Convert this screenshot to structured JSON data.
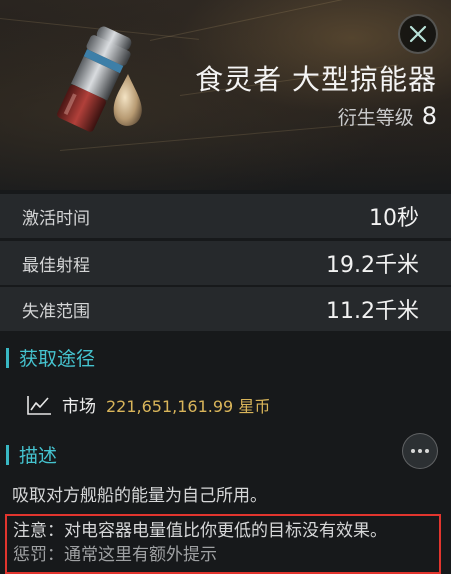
{
  "header": {
    "title": "食灵者 大型掠能器",
    "meta_label": "衍生等级",
    "meta_value": "8",
    "close_icon": "close-x-icon",
    "item_icon": "energy-canister-icon"
  },
  "attributes": [
    {
      "label": "激活时间",
      "value": "10秒"
    },
    {
      "label": "最佳射程",
      "value": "19.2千米"
    },
    {
      "label": "失准范围",
      "value": "11.2千米"
    }
  ],
  "acquisition": {
    "title": "获取途径",
    "market_icon": "market-chart-icon",
    "market_label": "市场",
    "market_price": "221,651,161.99 星币"
  },
  "description": {
    "title": "描述",
    "more_icon": "more-dots-icon",
    "text": "吸取对方舰船的能量为自己所用。",
    "note": "注意：对电容器电量值比你更低的目标没有效果。",
    "note_cutoff": "惩罚：通常这里有额外提示"
  },
  "colors": {
    "accent": "#45c3cf",
    "price": "#d9b55a",
    "highlight_border": "#e2352e"
  }
}
